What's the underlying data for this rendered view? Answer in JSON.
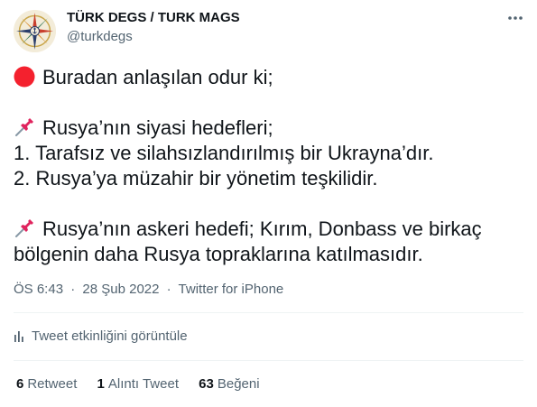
{
  "user": {
    "display_name": "TÜRK DEGS / TURK MAGS",
    "handle": "@turkdegs"
  },
  "tweet": {
    "line1": "Buradan anlaşılan odur ki;",
    "line2": "Rusya’nın siyasi hedefleri;",
    "line3": "1. Tarafsız ve silahsızlandırılmış bir Ukrayna’dır.",
    "line4": "2. Rusya’ya müzahir bir yönetim teşkilidir.",
    "line5": "Rusya’nın askeri hedefi; Kırım, Donbass ve birkaç",
    "line6": "bölgenin daha Rusya topraklarına katılmasıdır.",
    "emojis": [
      "red-circle",
      "pushpin",
      "pushpin"
    ]
  },
  "meta": {
    "time": "ÖS 6:43",
    "date": "28 Şub 2022",
    "source": "Twitter for iPhone",
    "separator": "·"
  },
  "activity": {
    "label": "Tweet etkinliğini görüntüle",
    "icon": "analytics-icon"
  },
  "stats": {
    "retweets_count": "6",
    "retweets_label": "Retweet",
    "quotes_count": "1",
    "quotes_label": "Alıntı Tweet",
    "likes_count": "63",
    "likes_label": "Beğeni"
  },
  "colors": {
    "text_primary": "#0f1419",
    "text_secondary": "#536471",
    "divider": "#eff3f4",
    "red_circle": "#f4212e",
    "pushpin": "#e0245e"
  }
}
